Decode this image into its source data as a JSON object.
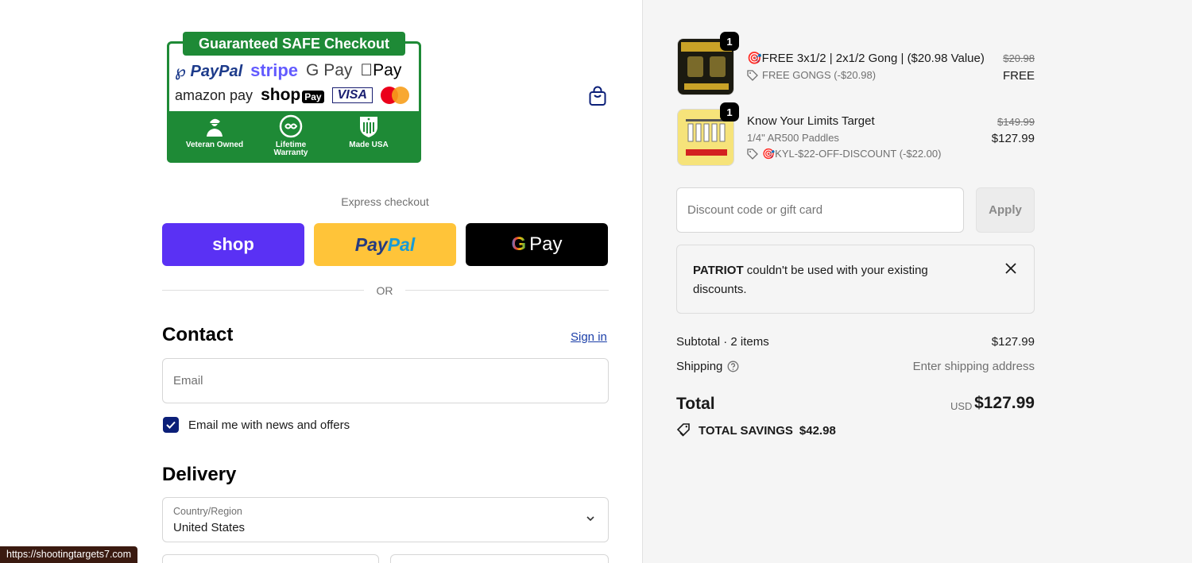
{
  "badge": {
    "title": "Guaranteed SAFE Checkout",
    "pay_logos": [
      "PayPal",
      "stripe",
      "G Pay",
      "Pay",
      "amazon pay",
      "shop",
      "Pay",
      "VISA"
    ],
    "trust": [
      {
        "label": "Veteran Owned"
      },
      {
        "label": "Lifetime Warranty"
      },
      {
        "label": "Made USA"
      }
    ]
  },
  "express": {
    "label": "Express checkout",
    "shop_label": "shop",
    "paypal_label_1": "Pay",
    "paypal_label_2": "Pal",
    "gpay_label": "Pay",
    "or": "OR"
  },
  "contact": {
    "heading": "Contact",
    "sign_in": "Sign in",
    "email_placeholder": "Email",
    "news_label": "Email me with news and offers"
  },
  "delivery": {
    "heading": "Delivery",
    "country_label": "Country/Region",
    "country_value": "United States"
  },
  "status_url": "https://shootingtargets7.com",
  "cart": {
    "items": [
      {
        "qty": "1",
        "name": "🎯FREE 3x1/2 | 2x1/2 Gong | ($20.98 Value)",
        "discount": "FREE GONGS (-$20.98)",
        "old_price": "$20.98",
        "price": "FREE"
      },
      {
        "qty": "1",
        "name": "Know Your Limits Target",
        "variant": "1/4\" AR500 Paddles",
        "discount": "🎯KYL-$22-OFF-DISCOUNT (-$22.00)",
        "old_price": "$149.99",
        "price": "$127.99"
      }
    ],
    "discount_placeholder": "Discount code or gift card",
    "apply_label": "Apply",
    "notice_code": "PATRIOT",
    "notice_text": " couldn't be used with your existing discounts.",
    "subtotal_label": "Subtotal · 2 items",
    "subtotal_value": "$127.99",
    "shipping_label": "Shipping",
    "shipping_value": "Enter shipping address",
    "total_label": "Total",
    "currency": "USD",
    "total_value": "$127.99",
    "savings_label": "TOTAL SAVINGS",
    "savings_value": "$42.98"
  },
  "colors": {
    "badge_green": "#1e8a36",
    "shop_purple": "#5a31f4",
    "paypal_yellow": "#ffc439",
    "checkbox_navy": "#0b1f78",
    "link_blue": "#1a3ea8"
  }
}
